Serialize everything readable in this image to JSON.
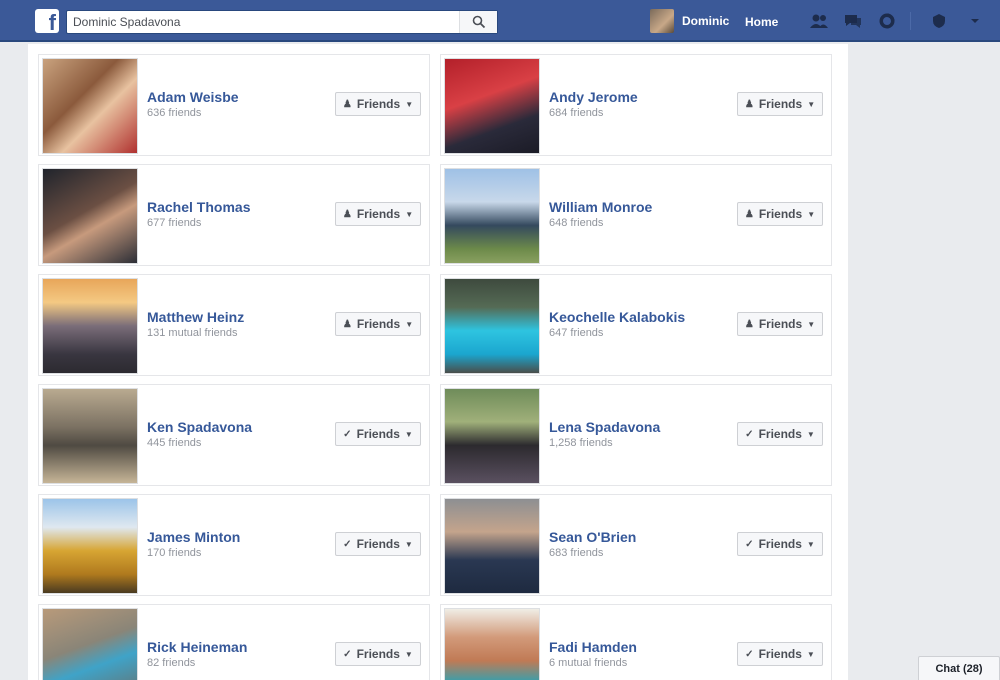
{
  "topbar": {
    "logo": "f",
    "search_value": "Dominic Spadavona",
    "user_name": "Dominic",
    "home_label": "Home",
    "icons": [
      "friend-requests-icon",
      "messages-icon",
      "notifications-icon"
    ],
    "extra_icons": [
      "privacy-icon",
      "account-menu-icon"
    ]
  },
  "friends": [
    {
      "name": "Adam Weisbe",
      "sub": "636 friends",
      "button": "Friends",
      "button_icon": "person-icon"
    },
    {
      "name": "Andy Jerome",
      "sub": "684 friends",
      "button": "Friends",
      "button_icon": "person-icon"
    },
    {
      "name": "Rachel Thomas",
      "sub": "677 friends",
      "button": "Friends",
      "button_icon": "person-icon"
    },
    {
      "name": "William Monroe",
      "sub": "648 friends",
      "button": "Friends",
      "button_icon": "person-icon"
    },
    {
      "name": "Matthew Heinz",
      "sub": "131 mutual friends",
      "button": "Friends",
      "button_icon": "person-icon"
    },
    {
      "name": "Keochelle Kalabokis",
      "sub": "647 friends",
      "button": "Friends",
      "button_icon": "person-icon"
    },
    {
      "name": "Ken Spadavona",
      "sub": "445 friends",
      "button": "Friends",
      "button_icon": "check-icon"
    },
    {
      "name": "Lena Spadavona",
      "sub": "1,258 friends",
      "button": "Friends",
      "button_icon": "check-icon"
    },
    {
      "name": "James Minton",
      "sub": "170 friends",
      "button": "Friends",
      "button_icon": "check-icon"
    },
    {
      "name": "Sean O'Brien",
      "sub": "683 friends",
      "button": "Friends",
      "button_icon": "check-icon"
    },
    {
      "name": "Rick Heineman",
      "sub": "82 friends",
      "button": "Friends",
      "button_icon": "check-icon"
    },
    {
      "name": "Fadi Hamden",
      "sub": "6 mutual friends",
      "button": "Friends",
      "button_icon": "check-icon"
    }
  ],
  "chat": {
    "label": "Chat (28)"
  },
  "colors": {
    "brand": "#3b5998",
    "link": "#365899",
    "muted": "#90949c"
  }
}
